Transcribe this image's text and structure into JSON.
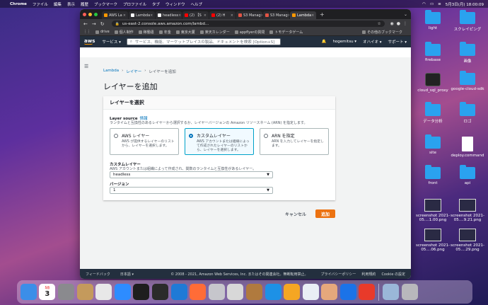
{
  "menubar": {
    "app": "Chrome",
    "items": [
      "ファイル",
      "編集",
      "表示",
      "履歴",
      "ブックマーク",
      "プロファイル",
      "タブ",
      "ウィンドウ",
      "ヘルプ"
    ],
    "clock": "5月3日(月) 18:00:09"
  },
  "browser": {
    "tabs": [
      {
        "label": "AWS La",
        "color": "#ff9900"
      },
      {
        "label": "Lambda",
        "color": "#ffffff"
      },
      {
        "label": "headless",
        "color": "#ffffff"
      },
      {
        "label": "(2) 【S",
        "color": "#ff0000"
      },
      {
        "label": "(2) H",
        "color": "#ff0000"
      },
      {
        "label": "S3 Manag",
        "color": "#e25444"
      },
      {
        "label": "S3 Manag",
        "color": "#e25444"
      },
      {
        "label": "Lambda",
        "color": "#ff9900"
      }
    ],
    "url": "us-east-2.console.aws.amazon.com/lambd...",
    "bookmarks": [
      "drive",
      "個人制作",
      "稼働違",
      "年金",
      "東京大厦",
      "楽天カレンダー",
      "appflyerの質問",
      "トモデータゲーム"
    ],
    "other_bookmarks": "その他のブックマーク"
  },
  "aws": {
    "services": "サービス ▾",
    "search_placeholder": "サービス、機能、マーケットプレイスの製品、ドキュメントを検索 [Option+S]",
    "user": "hogemitsu ▾",
    "region": "オハイオ ▾",
    "support": "サポート ▾",
    "breadcrumb": [
      "Lambda",
      "レイヤー",
      "レイヤーを追加"
    ],
    "page_title": "レイヤーを追加",
    "panel_title": "レイヤーを選択",
    "layer_source_label": "Layer source",
    "info": "情報",
    "layer_source_desc": "ランタイムと互換性のあるレイヤーから選択するか、レイヤーバージョンの Amazon リソースネーム (ARN) を指定します。",
    "options": [
      {
        "title": "AWS レイヤー",
        "desc": "AWS が提供するレイヤーのリストから、レイヤーを選択します。"
      },
      {
        "title": "カスタムレイヤー",
        "desc": "AWS アカウントまたは組織によって作成されたレイヤーのリストから、レイヤーを選択します。"
      },
      {
        "title": "ARN を指定",
        "desc": "ARN を入力してレイヤーを指定します。"
      }
    ],
    "custom_layer_label": "カスタムレイヤー",
    "custom_layer_desc": "AWS アカウントまたは組織によって作成され、関数のランタイムと互換性があるレイヤー。",
    "custom_layer_value": "headless",
    "version_label": "バージョン",
    "version_value": "1",
    "cancel": "キャンセル",
    "add": "追加",
    "footer": {
      "feedback": "フィードバック",
      "language": "日本語 ▾",
      "copyright": "© 2008 - 2021, Amazon Web Services, Inc. またはその関連会社。無断転用禁止。",
      "privacy": "プライバシーポリシー",
      "terms": "利用規約",
      "cookie": "Cookie の設定"
    }
  },
  "desktop": [
    {
      "label": "light",
      "type": "folder"
    },
    {
      "label": "スクレイピング",
      "type": "folder"
    },
    {
      "label": "firebase",
      "type": "folder"
    },
    {
      "label": "画像",
      "type": "folder"
    },
    {
      "label": "cloud_sql_proxy",
      "type": "terminal"
    },
    {
      "label": "google-cloud-sdk",
      "type": "folder"
    },
    {
      "label": "データ分析",
      "type": "folder"
    },
    {
      "label": "ロゴ",
      "type": "folder"
    },
    {
      "label": "site",
      "type": "folder"
    },
    {
      "label": "deploy.command",
      "type": "doc"
    },
    {
      "label": "front",
      "type": "folder"
    },
    {
      "label": "api",
      "type": "folder"
    },
    {
      "label": "screenshot 2021-05....1.00.png",
      "type": "shot"
    },
    {
      "label": "screenshot 2021-05....9.21.png",
      "type": "shot"
    },
    {
      "label": "screenshot 2021-05....06.png",
      "type": "shot"
    },
    {
      "label": "screenshot 2021-05....29.png",
      "type": "shot"
    }
  ],
  "dock": {
    "calendar_date": "3",
    "calendar_month": "5月",
    "apps": [
      "finder",
      "calendar",
      "system-preferences",
      "contacts",
      "chrome",
      "zoom",
      "terminal",
      "terminal-2",
      "vscode",
      "postman",
      "quicktime",
      "sequel",
      "keg",
      "docker",
      "cluster",
      "safari",
      "app",
      "infinity",
      "clock",
      "preview",
      "trash"
    ]
  }
}
